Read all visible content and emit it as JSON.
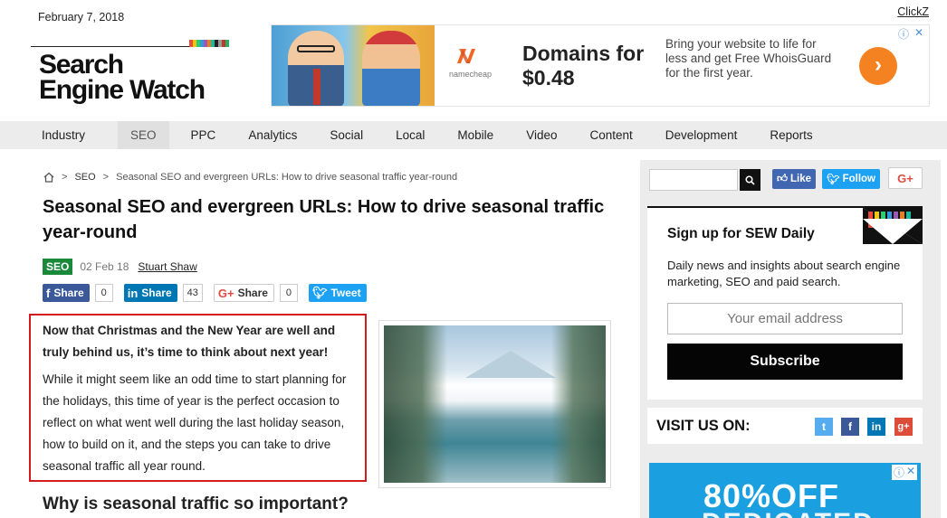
{
  "header": {
    "date": "February 7, 2018",
    "top_link": "ClickZ",
    "logo_line1": "Search",
    "logo_line2": "Engine Watch",
    "logo_bar_colors": [
      "#e74c3c",
      "#f1c40f",
      "#2ecc71",
      "#3498db",
      "#9b59b6",
      "#e67e22",
      "#1abc9c",
      "#222222",
      "#999999",
      "#c0392b",
      "#27ae60"
    ]
  },
  "ad_banner": {
    "brand": "namecheap",
    "title": "Domains for $0.48",
    "description": "Bring your website to life for less and get Free WhoisGuard for the first year.",
    "cta_icon": "arrow-right-icon",
    "choices_icons": [
      "info-icon",
      "close-icon"
    ]
  },
  "nav": {
    "items": [
      "Industry",
      "SEO",
      "PPC",
      "Analytics",
      "Social",
      "Local",
      "Mobile",
      "Video",
      "Content",
      "Development",
      "Reports"
    ],
    "active": "SEO"
  },
  "breadcrumb": {
    "home_icon": "home-icon",
    "section": "SEO",
    "current": "Seasonal SEO and evergreen URLs: How to drive seasonal traffic year-round"
  },
  "article": {
    "title": "Seasonal SEO and evergreen URLs: How to drive seasonal traffic year-round",
    "category_badge": "SEO",
    "date": "02 Feb 18",
    "author": "Stuart Shaw",
    "lead_bold": "Now that Christmas and the New Year are well and truly behind us, it’s time to think about next year!",
    "lead_text": "While it might seem like an odd time to start planning for the holidays, this time of year is the perfect occasion to reflect on what went well during the last holiday season, how to build on it, and the steps you can take to drive seasonal traffic all year round.",
    "subheading": "Why is seasonal traffic so important?"
  },
  "shares": {
    "facebook": {
      "label": "Share",
      "count": "0"
    },
    "linkedin": {
      "label": "Share",
      "count": "43"
    },
    "google": {
      "label": "Share",
      "count": "0"
    },
    "twitter": {
      "label": "Tweet"
    }
  },
  "sidebar": {
    "like_label": "Like",
    "follow_label": "Follow",
    "gplus_label": "G+",
    "signup_title": "Sign up for SEW Daily",
    "signup_desc": "Daily news and insights about search engine marketing, SEO and paid search.",
    "email_placeholder": "Your email address",
    "subscribe_label": "Subscribe",
    "visit_label": "VISIT US ON:",
    "social_icons": [
      "twitter-icon",
      "facebook-icon",
      "linkedin-icon",
      "google-plus-icon"
    ],
    "ad_text": "80%OFF",
    "ad_text2": "DEDICATED"
  }
}
